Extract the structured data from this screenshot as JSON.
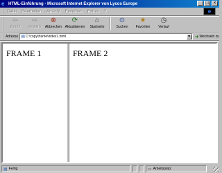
{
  "window": {
    "title": "HTML-Einführung - Microsoft Internet Explorer von Lycos Europe",
    "minimize": "_",
    "maximize": "□",
    "close": "×"
  },
  "menubar": {
    "items": [
      "Datei",
      "Bearbeiten",
      "Ansicht",
      "Favoriten",
      "Extras",
      "?"
    ]
  },
  "toolbar": {
    "buttons": [
      {
        "label": "Zurück",
        "icon": "back-arrow-icon",
        "glyph": "⇦",
        "enabled": false
      },
      {
        "label": "Vorwärts",
        "icon": "forward-arrow-icon",
        "glyph": "⇨",
        "enabled": false
      },
      {
        "label": "Abbrechen",
        "icon": "stop-icon",
        "glyph": "⊗",
        "enabled": true
      },
      {
        "label": "Aktualisieren",
        "icon": "refresh-icon",
        "glyph": "⟳",
        "enabled": true
      },
      {
        "label": "Startseite",
        "icon": "home-icon",
        "glyph": "⌂",
        "enabled": true
      },
      {
        "label": "Suchen",
        "icon": "search-icon",
        "glyph": "⊙",
        "enabled": true
      },
      {
        "label": "Favoriten",
        "icon": "favorites-icon",
        "glyph": "★",
        "enabled": true
      },
      {
        "label": "Verlauf",
        "icon": "history-icon",
        "glyph": "◷",
        "enabled": true
      }
    ]
  },
  "address": {
    "label": "Adresse",
    "value": "C:\\copy\\frame\\index1.html",
    "go_label": "Wechseln zu"
  },
  "frames": {
    "left_text": "FRAME 1",
    "right_text": "FRAME 2"
  },
  "status": {
    "text": "Fertig",
    "zone": "Arbeitsplatz"
  }
}
